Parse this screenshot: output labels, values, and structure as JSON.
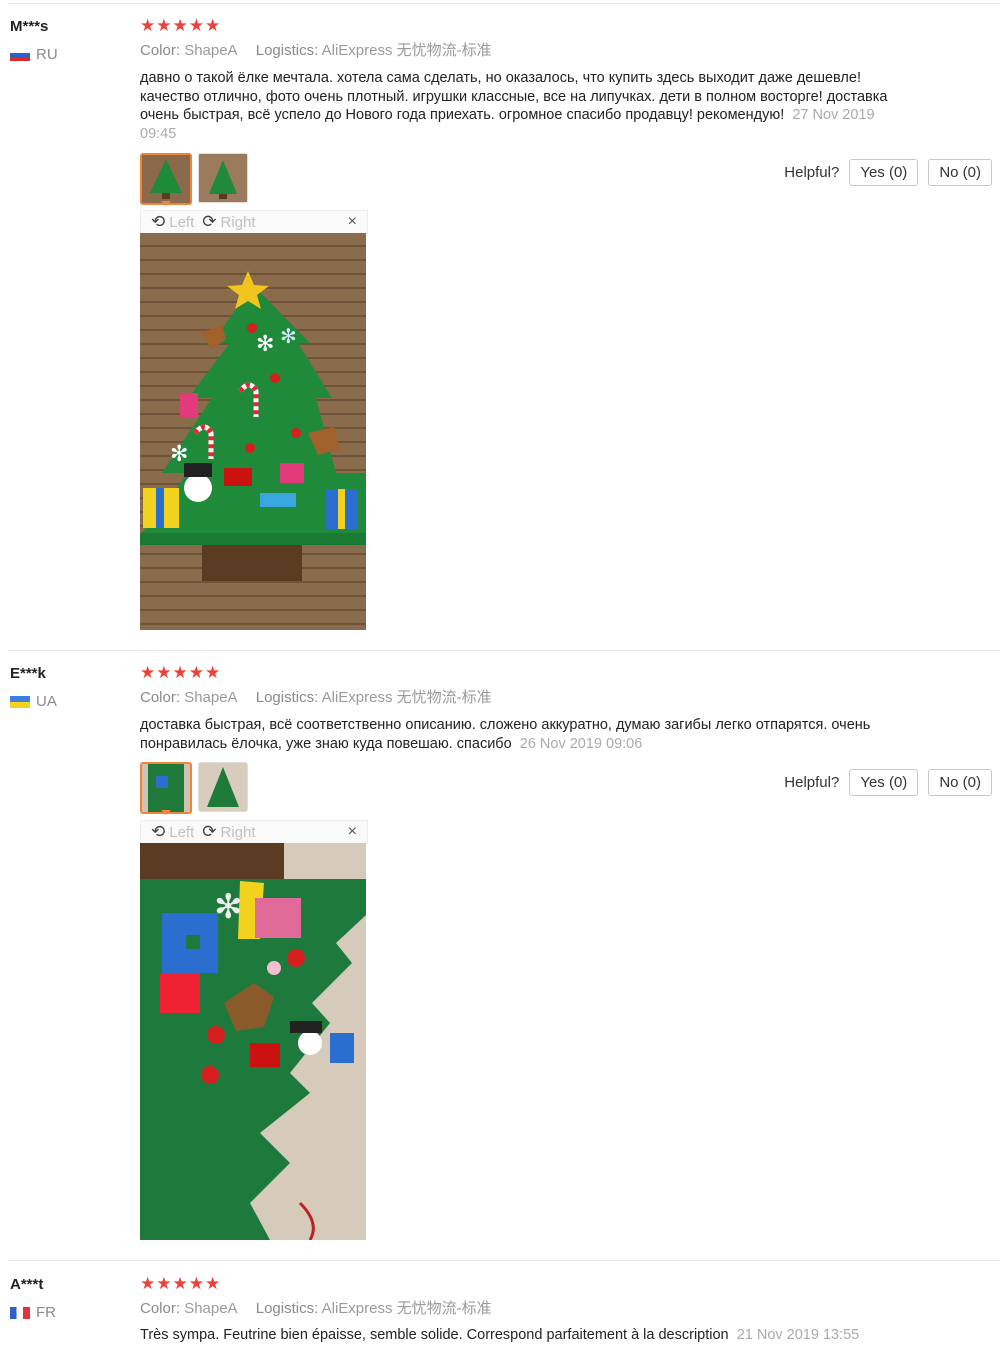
{
  "reviews": [
    {
      "user": "M***s",
      "country": "RU",
      "stars": "★★★★★",
      "color_label": "Color:",
      "color_value": "ShapeA",
      "logistics_label": "Logistics:",
      "logistics_value": "AliExpress 无忧物流-标准",
      "text": "давно о такой ёлке мечтала. хотела сама сделать, но оказалось, что купить здесь выходит даже дешевле! качество отлично, фото очень плотный. игрушки классные, все на липучках. дети в полном восторге! доставка очень быстрая, всё успело до Нового года приехать. огромное спасибо продавцу! рекомендую!",
      "date": "27 Nov 2019 09:45",
      "helpful_label": "Helpful?",
      "yes_label": "Yes (0)",
      "no_label": "No (0)",
      "rotate_left": "Left",
      "rotate_right": "Right",
      "close": "×"
    },
    {
      "user": "E***k",
      "country": "UA",
      "stars": "★★★★★",
      "color_label": "Color:",
      "color_value": "ShapeA",
      "logistics_label": "Logistics:",
      "logistics_value": "AliExpress 无忧物流-标准",
      "text": "доставка быстрая, всё соответственно описанию. сложено аккуратно, думаю загибы легко отпарятся. очень понравилась ёлочка, уже знаю куда повешаю. спасибо",
      "date": "26 Nov 2019 09:06",
      "helpful_label": "Helpful?",
      "yes_label": "Yes (0)",
      "no_label": "No (0)",
      "rotate_left": "Left",
      "rotate_right": "Right",
      "close": "×"
    },
    {
      "user": "A***t",
      "country": "FR",
      "stars": "★★★★★",
      "color_label": "Color:",
      "color_value": "ShapeA",
      "logistics_label": "Logistics:",
      "logistics_value": "AliExpress 无忧物流-标准",
      "text": "Très sympa. Feutrine bien épaisse, semble solide. Correspond parfaitement à la description",
      "date": "21 Nov 2019 13:55"
    }
  ],
  "colors": {
    "star": "#f0403a",
    "thumb_active_border": "#f0843a",
    "felt_green": "#1f8a3a",
    "trunk_brown": "#5b3a22"
  }
}
